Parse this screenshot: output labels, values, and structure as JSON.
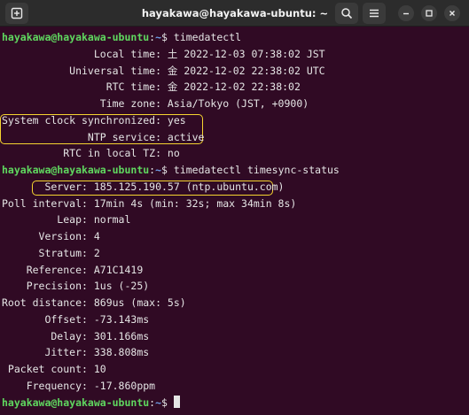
{
  "window": {
    "title": "hayakawa@hayakawa-ubuntu: ~"
  },
  "prompt": {
    "user_host": "hayakawa@hayakawa-ubuntu",
    "path": "~",
    "symbol": "$"
  },
  "lines": [
    {
      "type": "prompt",
      "cmd": "timedatectl"
    },
    {
      "type": "text",
      "text": "               Local time: 土 2022-12-03 07:38:02 JST"
    },
    {
      "type": "text",
      "text": "           Universal time: 金 2022-12-02 22:38:02 UTC"
    },
    {
      "type": "text",
      "text": "                 RTC time: 金 2022-12-02 22:38:02"
    },
    {
      "type": "text",
      "text": "                Time zone: Asia/Tokyo (JST, +0900)"
    },
    {
      "type": "text",
      "text": "System clock synchronized: yes"
    },
    {
      "type": "text",
      "text": "              NTP service: active"
    },
    {
      "type": "text",
      "text": "          RTC in local TZ: no"
    },
    {
      "type": "prompt",
      "cmd": "timedatectl timesync-status"
    },
    {
      "type": "text",
      "text": "       Server: 185.125.190.57 (ntp.ubuntu.com)"
    },
    {
      "type": "text",
      "text": "Poll interval: 17min 4s (min: 32s; max 34min 8s)"
    },
    {
      "type": "text",
      "text": "         Leap: normal"
    },
    {
      "type": "text",
      "text": "      Version: 4"
    },
    {
      "type": "text",
      "text": "      Stratum: 2"
    },
    {
      "type": "text",
      "text": "    Reference: A71C1419"
    },
    {
      "type": "text",
      "text": "    Precision: 1us (-25)"
    },
    {
      "type": "text",
      "text": "Root distance: 869us (max: 5s)"
    },
    {
      "type": "text",
      "text": "       Offset: -73.143ms"
    },
    {
      "type": "text",
      "text": "        Delay: 301.166ms"
    },
    {
      "type": "text",
      "text": "       Jitter: 338.808ms"
    },
    {
      "type": "text",
      "text": " Packet count: 10"
    },
    {
      "type": "text",
      "text": "    Frequency: -17.860ppm"
    },
    {
      "type": "prompt",
      "cmd": ""
    }
  ],
  "colors": {
    "background": "#300a24",
    "prompt_user": "#5fd75f",
    "prompt_path": "#6f9fe8",
    "highlight": "#f5d430"
  },
  "icons": {
    "new_tab": "new-tab-icon",
    "search": "search-icon",
    "menu": "hamburger-menu-icon",
    "minimize": "minimize-icon",
    "maximize": "maximize-icon",
    "close": "close-icon"
  }
}
